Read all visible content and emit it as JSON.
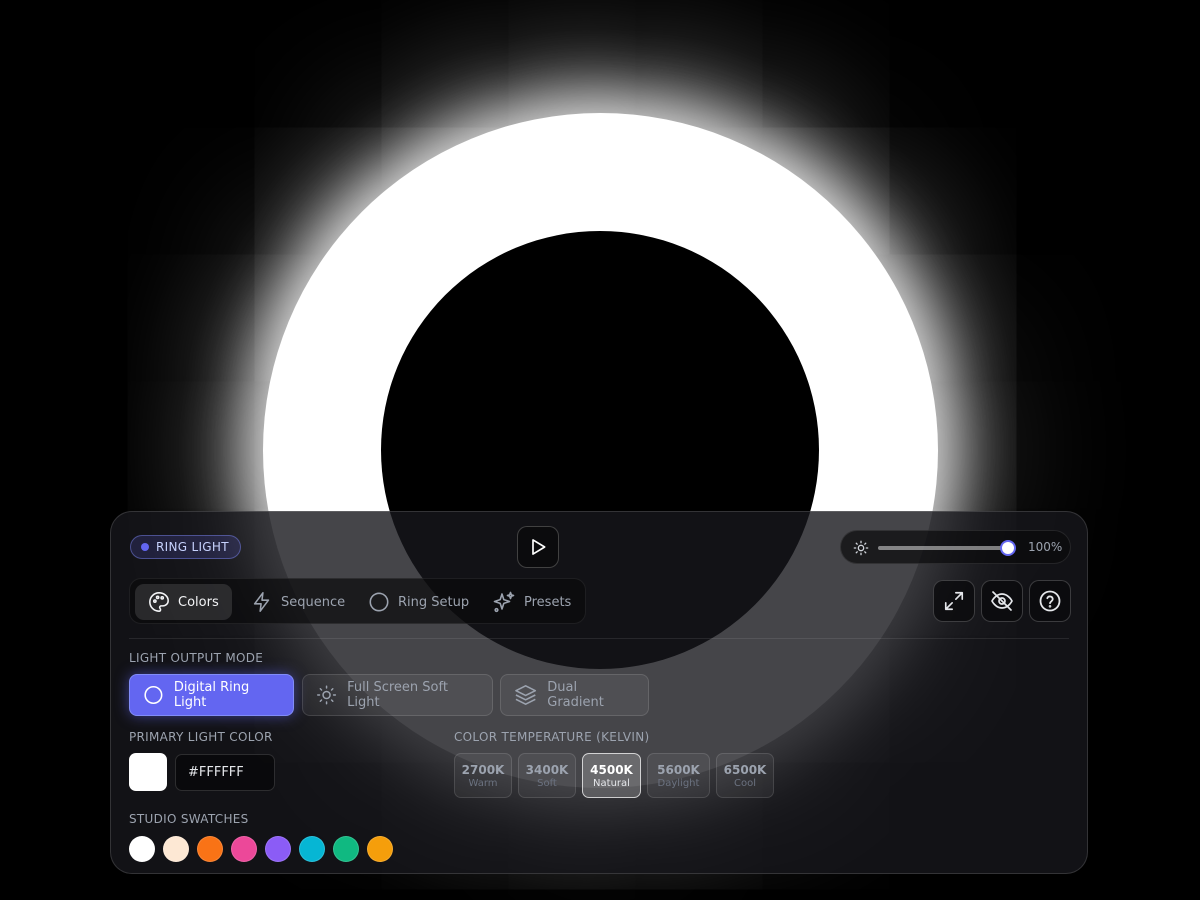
{
  "badge": {
    "label": "RING LIGHT",
    "color": "#6366f1"
  },
  "brightness": {
    "value": 100,
    "label": "100%"
  },
  "tabs": [
    {
      "label": "Colors",
      "icon": "palette-icon",
      "active": true
    },
    {
      "label": "Sequence",
      "icon": "lightning-icon",
      "active": false
    },
    {
      "label": "Ring Setup",
      "icon": "circle-icon",
      "active": false
    },
    {
      "label": "Presets",
      "icon": "sparkles-icon",
      "active": false
    }
  ],
  "toolbar": {
    "fullscreen_icon": "expand-icon",
    "hide_icon": "eye-off-icon",
    "help_icon": "help-icon"
  },
  "light_output": {
    "label": "LIGHT OUTPUT MODE",
    "modes": [
      {
        "label": "Digital Ring Light",
        "icon": "circle-icon",
        "active": true
      },
      {
        "label": "Full Screen Soft Light",
        "icon": "sun-icon",
        "active": false
      },
      {
        "label": "Dual Gradient",
        "icon": "layers-icon",
        "active": false
      }
    ]
  },
  "primary_color": {
    "label": "PRIMARY LIGHT COLOR",
    "hex": "#FFFFFF"
  },
  "temperature": {
    "label": "COLOR TEMPERATURE (KELVIN)",
    "options": [
      {
        "kelvin": "2700K",
        "name": "Warm",
        "active": false
      },
      {
        "kelvin": "3400K",
        "name": "Soft",
        "active": false
      },
      {
        "kelvin": "4500K",
        "name": "Natural",
        "active": true
      },
      {
        "kelvin": "5600K",
        "name": "Daylight",
        "active": false
      },
      {
        "kelvin": "6500K",
        "name": "Cool",
        "active": false
      }
    ]
  },
  "swatches": {
    "label": "STUDIO SWATCHES",
    "colors": [
      "#ffffff",
      "#fde8d4",
      "#f97316",
      "#ec4899",
      "#8b5cf6",
      "#06b6d4",
      "#10b981",
      "#f59e0b"
    ]
  },
  "accent": "#6366f1"
}
